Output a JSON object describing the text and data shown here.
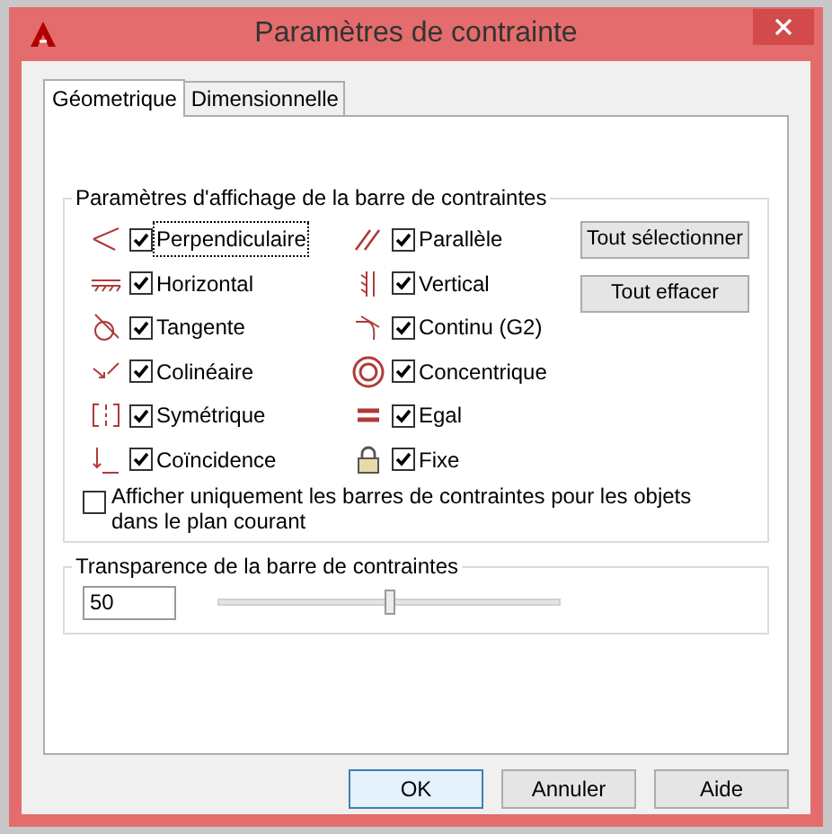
{
  "window": {
    "title": "Paramètres de contrainte"
  },
  "tabs": [
    {
      "label": "Géometrique",
      "selected": true
    },
    {
      "label": "Dimensionnelle",
      "selected": false
    }
  ],
  "display_group": {
    "title": "Paramètres d'affichage de la barre de contraintes",
    "constraints": [
      {
        "label": "Perpendiculaire",
        "checked": true,
        "focused": true
      },
      {
        "label": "Parallèle",
        "checked": true,
        "focused": false
      },
      {
        "label": "Horizontal",
        "checked": true,
        "focused": false
      },
      {
        "label": "Vertical",
        "checked": true,
        "focused": false
      },
      {
        "label": "Tangente",
        "checked": true,
        "focused": false
      },
      {
        "label": "Continu (G2)",
        "checked": true,
        "focused": false
      },
      {
        "label": "Colinéaire",
        "checked": true,
        "focused": false
      },
      {
        "label": "Concentrique",
        "checked": true,
        "focused": false
      },
      {
        "label": "Symétrique",
        "checked": true,
        "focused": false
      },
      {
        "label": "Egal",
        "checked": true,
        "focused": false
      },
      {
        "label": "Coïncidence",
        "checked": true,
        "focused": false
      },
      {
        "label": "Fixe",
        "checked": true,
        "focused": false
      }
    ],
    "buttons": [
      "Tout sélectionner",
      "Tout effacer"
    ],
    "current_plane_only": {
      "label": "Afficher uniquement les barres de contraintes pour les objets dans le plan courant",
      "checked": false
    }
  },
  "transparency_group": {
    "title": "Transparence de la barre de contraintes",
    "value": "50",
    "level": 0.5
  },
  "buttons": [
    {
      "label": "OK",
      "default": true
    },
    {
      "label": "Annuler",
      "default": false
    },
    {
      "label": "Aide",
      "default": false
    }
  ]
}
